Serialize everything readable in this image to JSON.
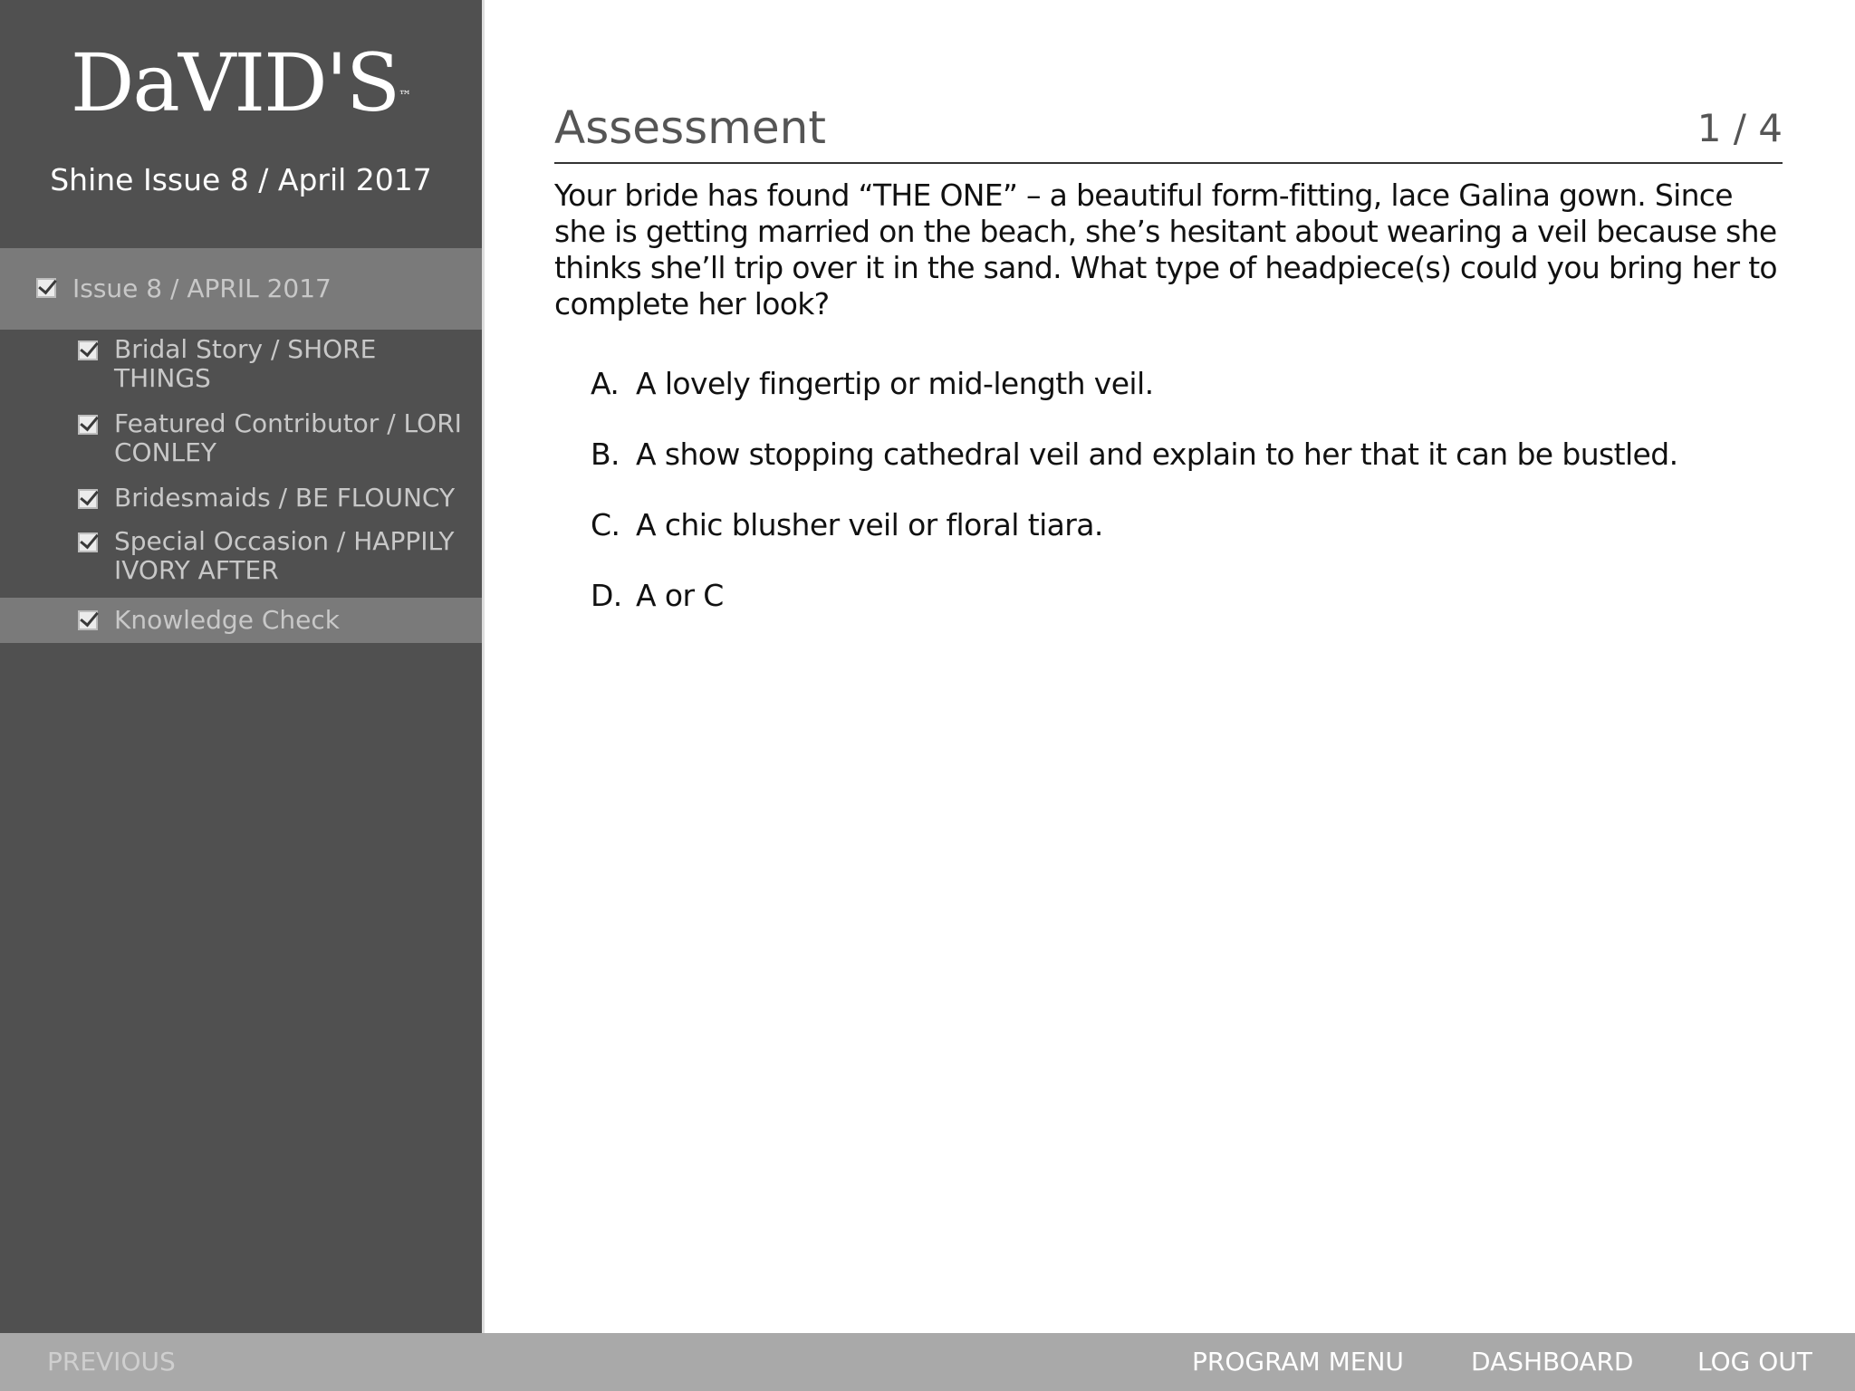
{
  "sidebar": {
    "logo_text": "DaVID'S",
    "logo_tm": "™",
    "course_title": "Shine Issue 8 / April 2017",
    "items": [
      {
        "label": "Issue 8 / APRIL 2017",
        "checked": true
      },
      {
        "label": "Bridal Story / SHORE THINGS",
        "checked": true
      },
      {
        "label": "Featured Contributor / LORI CONLEY",
        "checked": true
      },
      {
        "label": "Bridesmaids / BE FLOUNCY",
        "checked": true
      },
      {
        "label": "Special Occasion / HAPPILY IVORY AFTER",
        "checked": true
      },
      {
        "label": "Knowledge Check",
        "checked": true
      }
    ]
  },
  "main": {
    "title": "Assessment",
    "progress": "1 / 4",
    "question": "Your bride has found “THE ONE” – a beautiful form-fitting, lace Galina gown. Since she is getting married on the beach, she’s hesitant about wearing a veil because she thinks she’ll trip over it in the sand. What type of headpiece(s) could you bring her to complete her look?",
    "answers": [
      {
        "letter": "A.",
        "text": "A lovely fingertip or mid-length veil."
      },
      {
        "letter": "B.",
        "text": "A show stopping cathedral veil and explain to her that it can be bustled."
      },
      {
        "letter": "C.",
        "text": "A chic blusher veil or floral tiara."
      },
      {
        "letter": "D.",
        "text": "A or C"
      }
    ]
  },
  "footer": {
    "previous": "PREVIOUS",
    "program_menu": "PROGRAM MENU",
    "dashboard": "DASHBOARD",
    "logout": "LOG OUT"
  },
  "colors": {
    "sidebar_bg": "#505050",
    "sidebar_highlight": "#7a7a7a",
    "footer_bg": "#a9a9a9",
    "text_dark": "#111111"
  }
}
